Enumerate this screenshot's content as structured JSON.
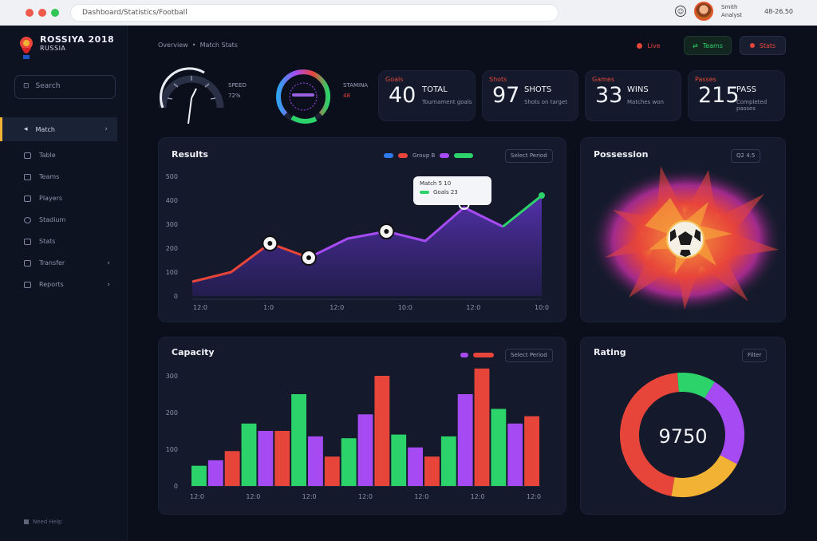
{
  "chrome": {
    "url": "Dashboard/Statistics/Football",
    "user_line1": "Smith",
    "user_line2": "Analyst",
    "date": "48-26.50",
    "icon": "chat-icon"
  },
  "brand": {
    "title": "ROSSIYA 2018",
    "subtitle": "RUSSIA"
  },
  "sidebar": {
    "search": "Search",
    "items": [
      {
        "label": "Match",
        "icon": "whistle-icon",
        "chevron": "›"
      },
      {
        "label": "Table",
        "icon": "table-icon"
      },
      {
        "label": "Teams",
        "icon": "teams-icon"
      },
      {
        "label": "Players",
        "icon": "players-icon"
      },
      {
        "label": "Stadium",
        "icon": "stadium-icon"
      },
      {
        "label": "Stats",
        "icon": "stats-icon"
      },
      {
        "label": "Transfer",
        "icon": "transfer-icon",
        "chevron": "›"
      },
      {
        "label": "Reports",
        "icon": "reports-icon",
        "chevron": "›"
      }
    ],
    "footer": "Need Help"
  },
  "breadcrumb": {
    "part1": "Overview",
    "sep": "•",
    "part2": "Match Stats"
  },
  "actions": [
    {
      "label": "Live",
      "icon": "live-icon",
      "color": "#e8453a"
    },
    {
      "label": "Teams",
      "icon": "share-icon",
      "color": "#2bd36a"
    },
    {
      "label": "Stats",
      "icon": "record-icon",
      "color": "#e8453a"
    }
  ],
  "gauges": [
    {
      "label1": "SPEED",
      "label2": "72%",
      "value": 0.72
    },
    {
      "label1": "STAMINA",
      "label2": "48",
      "value": 0.8
    }
  ],
  "stats": [
    {
      "value": "40",
      "caption": "Goals",
      "title": "TOTAL",
      "sub": "Tournament goals"
    },
    {
      "value": "97",
      "caption": "Shots",
      "title": "SHOTS",
      "sub": "Shots on target"
    },
    {
      "value": "33",
      "caption": "Games",
      "title": "WINS",
      "sub": "Matches won"
    },
    {
      "value": "215",
      "caption": "Passes",
      "title": "PASS",
      "sub": "Completed passes"
    }
  ],
  "line_panel": {
    "title": "Results",
    "legend": "Group B",
    "pill": "Select Period",
    "tooltip_l1": "Match 5   10",
    "tooltip_l2": "Goals 23",
    "colors": {
      "a": "#e8453a",
      "b": "#a64bf4",
      "c": "#2bd36a"
    }
  },
  "heat_panel": {
    "title": "Possession",
    "pill": "Q2 4.5"
  },
  "bar_panel": {
    "title": "Capacity",
    "pill": "Select Period"
  },
  "donut_panel": {
    "title": "Rating",
    "pill": "Filter",
    "center": "9750"
  },
  "chart_data": [
    {
      "type": "line",
      "title": "Results",
      "x": [
        "12:0",
        "1:0",
        "12:0",
        "10:0",
        "12:0",
        "10:0"
      ],
      "yticks": [
        "0",
        "100",
        "200",
        "300",
        "400",
        "500"
      ],
      "ylim": [
        0,
        500
      ],
      "series": [
        {
          "name": "Group B",
          "values": [
            60,
            100,
            220,
            160,
            240,
            270,
            230,
            370,
            290,
            420
          ]
        }
      ],
      "markers": [
        2,
        3,
        5
      ],
      "tooltip_index": 7
    },
    {
      "type": "bar",
      "title": "Capacity",
      "x": [
        "12:0",
        "12:0",
        "12:0",
        "12:0",
        "12:0",
        "12:0",
        "12:0"
      ],
      "yticks": [
        "0",
        "100",
        "200",
        "300"
      ],
      "ylim": [
        0,
        300
      ],
      "values": [
        55,
        70,
        95,
        170,
        150,
        150,
        250,
        135,
        80,
        130,
        195,
        300,
        140,
        105,
        80,
        135,
        250,
        320,
        210,
        170,
        190
      ],
      "colors": [
        "#2bd36a",
        "#a64bf4",
        "#e8453a",
        "#2bd36a",
        "#a64bf4",
        "#e8453a",
        "#2bd36a",
        "#a64bf4",
        "#e8453a",
        "#2bd36a",
        "#a64bf4",
        "#e8453a",
        "#2bd36a",
        "#a64bf4",
        "#e8453a",
        "#2bd36a",
        "#a64bf4",
        "#e8453a",
        "#2bd36a",
        "#a64bf4",
        "#e8453a"
      ]
    },
    {
      "type": "pie",
      "title": "Rating",
      "values": [
        46,
        10,
        24,
        20
      ],
      "colors": [
        "#e8453a",
        "#2bd36a",
        "#a64bf4",
        "#f2b233"
      ]
    }
  ]
}
